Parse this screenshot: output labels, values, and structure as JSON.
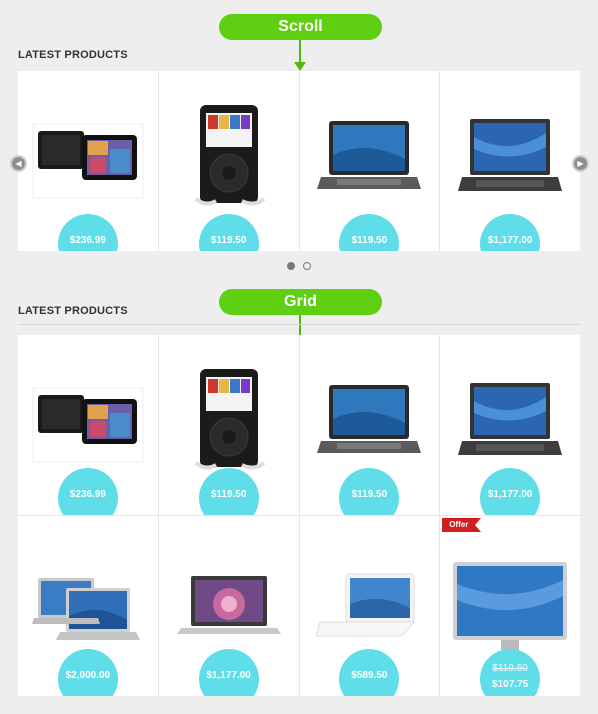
{
  "colors": {
    "accent_green": "#5fcf12",
    "price_badge": "#5fdde8",
    "offer_red": "#d21e1e"
  },
  "scroll_section": {
    "pill_label": "Scroll",
    "title": "LATEST PRODUCTS",
    "prev_icon": "chevron-left-icon",
    "next_icon": "chevron-right-icon",
    "pagination_pages": 2,
    "active_page": 1,
    "products": [
      {
        "name": "tablet",
        "price": "$236.99"
      },
      {
        "name": "ipod",
        "price": "$119.50"
      },
      {
        "name": "laptop",
        "price": "$119.50"
      },
      {
        "name": "vaio-laptop",
        "price": "$1,177.00"
      }
    ]
  },
  "grid_section": {
    "pill_label": "Grid",
    "title": "LATEST PRODUCTS",
    "products": [
      {
        "name": "tablet",
        "price": "$236.99"
      },
      {
        "name": "ipod",
        "price": "$119.50"
      },
      {
        "name": "laptop",
        "price": "$119.50"
      },
      {
        "name": "vaio-laptop",
        "price": "$1,177.00"
      },
      {
        "name": "macbook-pro-pair",
        "price": "$2,000.00"
      },
      {
        "name": "macbook-air",
        "price": "$1,177.00"
      },
      {
        "name": "white-macbook",
        "price": "$589.50"
      },
      {
        "name": "apple-cinema-display",
        "offer_label": "Offer",
        "old_price": "$119.50",
        "price": "$107.75"
      }
    ]
  }
}
